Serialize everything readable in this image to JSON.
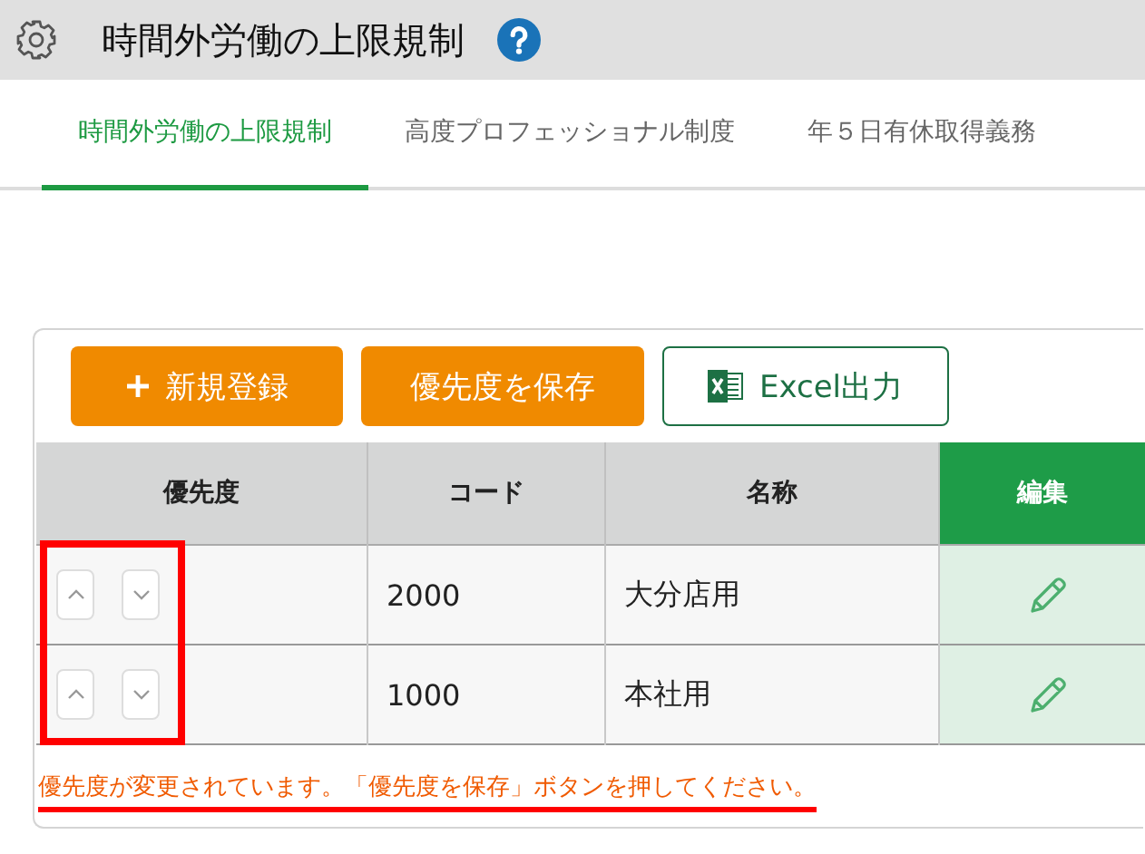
{
  "header": {
    "title": "時間外労働の上限規制"
  },
  "tabs": [
    {
      "label": "時間外労働の上限規制",
      "selected": true
    },
    {
      "label": "高度プロフェッショナル制度",
      "selected": false
    },
    {
      "label": "年５日有休取得義務",
      "selected": false
    }
  ],
  "toolbar": [
    {
      "kind": "add",
      "label": "新規登録"
    },
    {
      "kind": "save",
      "label": "優先度を保存"
    },
    {
      "kind": "excel",
      "label": "Excel出力"
    }
  ],
  "table": {
    "columns": [
      "優先度",
      "コード",
      "名称",
      "編集"
    ],
    "rows": [
      {
        "code": "2000",
        "name": "大分店用"
      },
      {
        "code": "1000",
        "name": "本社用"
      }
    ]
  },
  "notice": "優先度が変更されています。「優先度を保存」ボタンを押してください。",
  "annotations": {
    "priority_box": true,
    "notice_underline": true
  }
}
